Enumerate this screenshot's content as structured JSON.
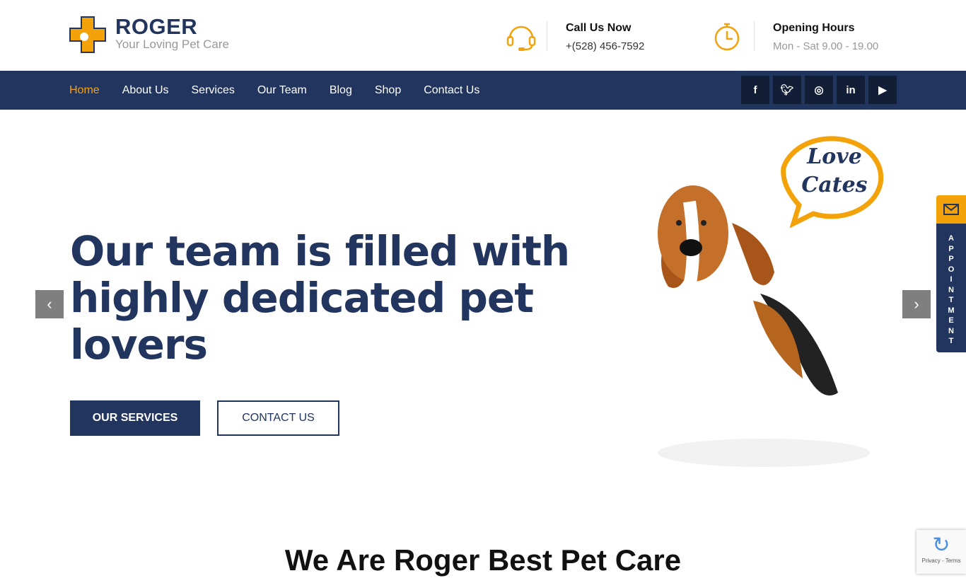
{
  "header": {
    "brand": "ROGER",
    "tagline": "Your Loving Pet Care",
    "call": {
      "title": "Call Us Now",
      "value": "+(528) 456-7592"
    },
    "hours": {
      "title": "Opening Hours",
      "value": "Mon - Sat 9.00 - 19.00"
    }
  },
  "nav": {
    "items": [
      "Home",
      "About Us",
      "Services",
      "Our Team",
      "Blog",
      "Shop",
      "Contact Us"
    ],
    "active": "Home",
    "social": [
      "f",
      "t",
      "ig",
      "in",
      "yt"
    ]
  },
  "hero": {
    "title": "Our team is filled with highly dedicated pet lovers",
    "primary": "OUR SERVICES",
    "secondary": "CONTACT US",
    "bubble": [
      "Love",
      "Cates"
    ]
  },
  "appointment": "APPOINTMENT",
  "section_title": "We Are Roger Best Pet Care",
  "recaptcha": "Privacy - Terms",
  "colors": {
    "navy": "#22355e",
    "orange": "#f4a20a"
  }
}
